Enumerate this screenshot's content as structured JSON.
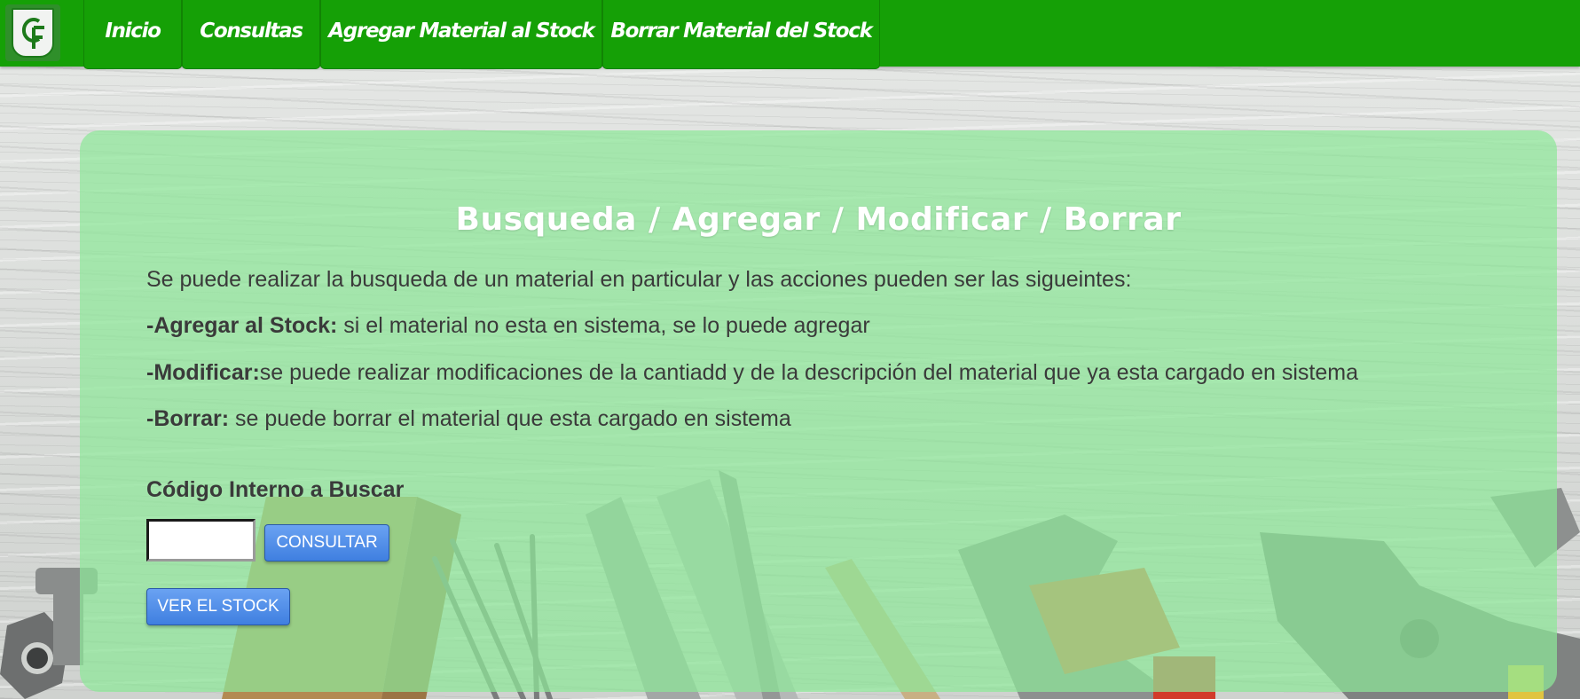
{
  "nav": {
    "items": [
      {
        "label": "Inicio"
      },
      {
        "label": "Consultas"
      },
      {
        "label": "Agregar Material al Stock"
      },
      {
        "label": "Borrar Material del Stock"
      }
    ]
  },
  "logo": {
    "text": "CF"
  },
  "panel": {
    "title": "Busqueda / Agregar / Modificar / Borrar",
    "intro": "Se puede realizar la busqueda de un material en particular y las acciones pueden ser las sigueintes:",
    "items": [
      {
        "label": "-Agregar al Stock:",
        "text": " si el material no esta en sistema, se lo puede agregar"
      },
      {
        "label": "-Modificar:",
        "text": "se puede realizar modificaciones de la cantiadd y de la descripción del material que ya esta cargado en sistema"
      },
      {
        "label": "-Borrar:",
        "text": " se puede borrar el material que esta cargado en sistema"
      }
    ],
    "field_label": "Código Interno a Buscar",
    "code_value": "",
    "consultar_label": "CONSULTAR",
    "ver_stock_label": "VER EL STOCK"
  },
  "colors": {
    "navbar": "#15a006",
    "panel": "#8ee898",
    "button": "#3f7fe0"
  }
}
